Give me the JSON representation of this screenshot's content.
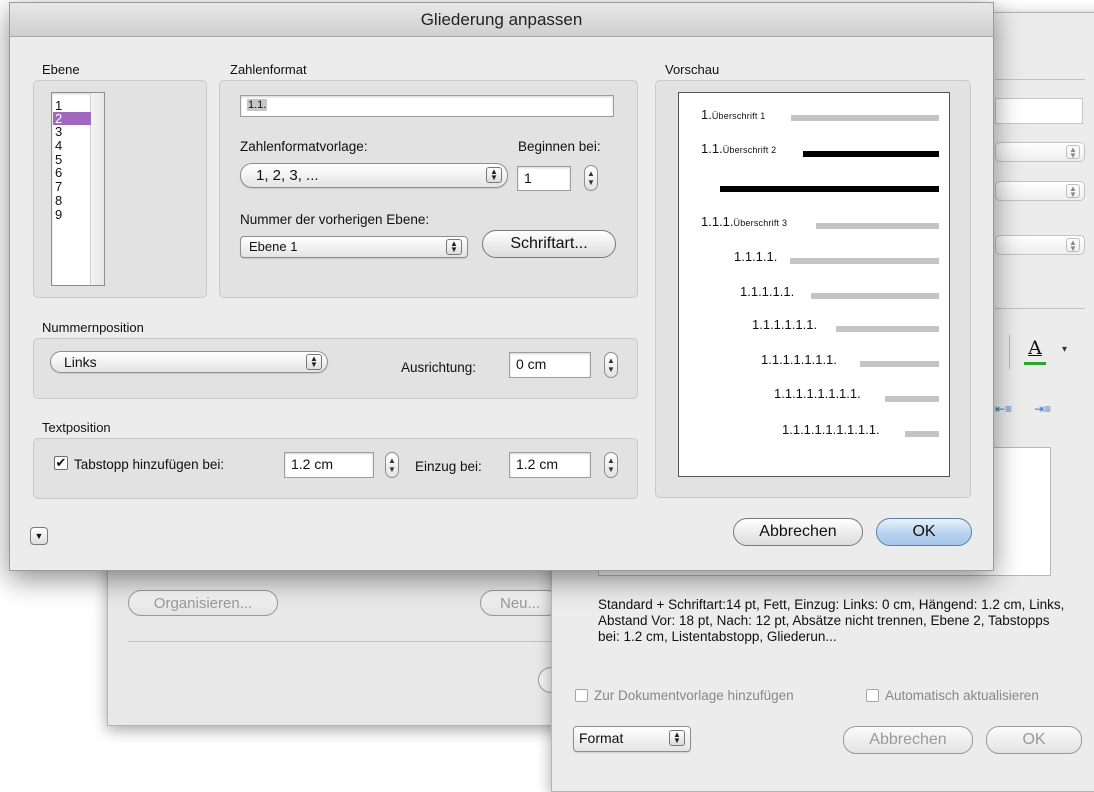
{
  "dialog": {
    "title": "Gliederung anpassen",
    "ebene": {
      "label": "Ebene",
      "items": [
        "1",
        "2",
        "3",
        "4",
        "5",
        "6",
        "7",
        "8",
        "9"
      ],
      "selected": "2"
    },
    "zahlenformat": {
      "label": "Zahlenformat",
      "value": "1.1.",
      "vorlage_label": "Zahlenformatvorlage:",
      "vorlage_value": "1, 2, 3, ...",
      "beginnen_label": "Beginnen bei:",
      "beginnen_value": "1",
      "vorherige_label": "Nummer der vorherigen Ebene:",
      "vorherige_value": "Ebene 1",
      "schriftart_button": "Schriftart..."
    },
    "nummernposition": {
      "label": "Nummernposition",
      "value": "Links",
      "ausrichtung_label": "Ausrichtung:",
      "ausrichtung_value": "0 cm"
    },
    "textposition": {
      "label": "Textposition",
      "tabstopp_label": "Tabstopp hinzufügen bei:",
      "tabstopp_checked": true,
      "tabstopp_value": "1.2 cm",
      "einzug_label": "Einzug bei:",
      "einzug_value": "1.2 cm"
    },
    "vorschau": {
      "label": "Vorschau",
      "rows": [
        {
          "number": "1.",
          "text": "Überschrift 1"
        },
        {
          "number": "1.1.",
          "text": "Überschrift 2"
        },
        {
          "number": "1.1.1.",
          "text": "Überschrift 3"
        },
        {
          "number": "1.1.1.1.",
          "text": ""
        },
        {
          "number": "1.1.1.1.1.",
          "text": ""
        },
        {
          "number": "1.1.1.1.1.1.",
          "text": ""
        },
        {
          "number": "1.1.1.1.1.1.1.",
          "text": ""
        },
        {
          "number": "1.1.1.1.1.1.1.1.",
          "text": ""
        },
        {
          "number": "1.1.1.1.1.1.1.1.1.",
          "text": ""
        }
      ]
    },
    "cancel_button": "Abbrechen",
    "ok_button": "OK"
  },
  "background_window": {
    "organisieren_button": "Organisieren...",
    "neu_button": "Neu..."
  },
  "style_window": {
    "description": "Standard + Schriftart:14 pt, Fett, Einzug: Links:  0 cm, Hängend: 1.2 cm, Links, Abstand Vor:  18 pt, Nach:  12 pt, Absätze nicht trennen, Ebene 2, Tabstopps bei: 1.2 cm, Listentabstopp, Gliederun...",
    "add_to_template_label": "Zur Dokumentvorlage hinzufügen",
    "auto_update_label": "Automatisch aktualisieren",
    "format_popup": "Format",
    "cancel_button": "Abbrechen",
    "ok_button": "OK",
    "font_color_glyph": "A",
    "accent_underline_color": "#2aa52a"
  }
}
